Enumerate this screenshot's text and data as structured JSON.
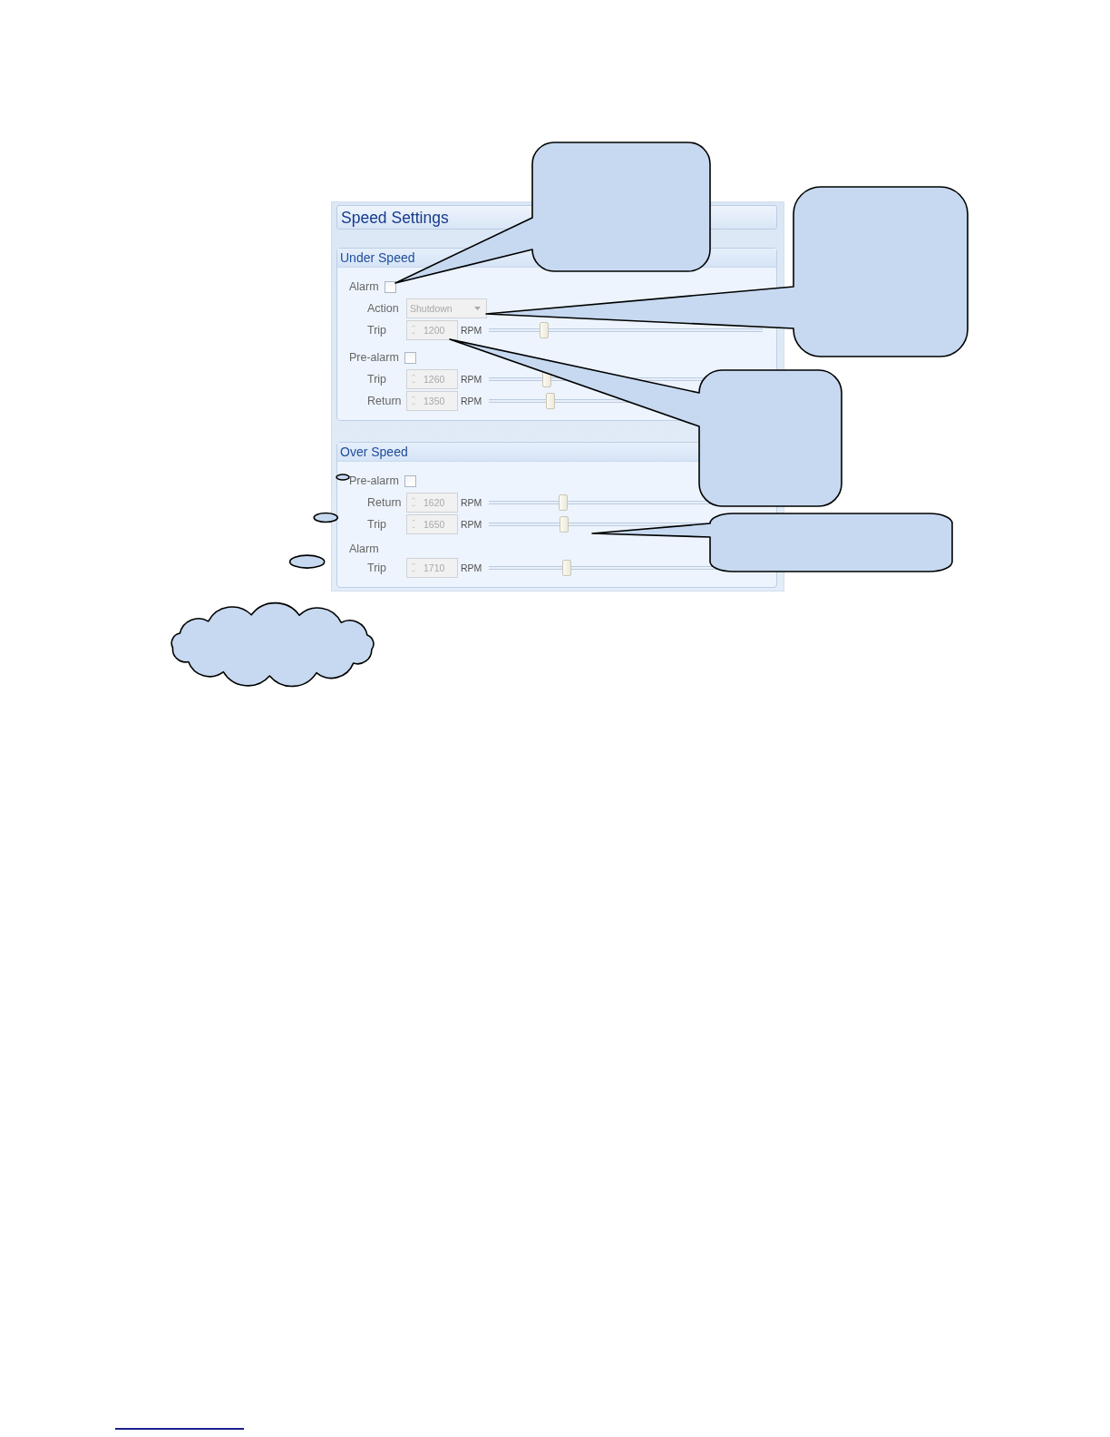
{
  "panel": {
    "title": "Speed Settings",
    "groups": [
      {
        "title": "Under Speed",
        "sections": [
          {
            "kind": "checkbox",
            "label": "Alarm",
            "checked": false,
            "children": [
              {
                "kind": "dropdown",
                "label": "Action",
                "value": "Shutdown",
                "disabled": true
              },
              {
                "kind": "spin",
                "label": "Trip",
                "value": "1200",
                "unit": "RPM",
                "level": 0.2,
                "disabled": true
              }
            ]
          },
          {
            "kind": "checkbox",
            "label": "Pre-alarm",
            "checked": false,
            "children": [
              {
                "kind": "spin",
                "label": "Trip",
                "value": "1260",
                "unit": "RPM",
                "level": 0.21,
                "disabled": true
              },
              {
                "kind": "spin",
                "label": "Return",
                "value": "1350",
                "unit": "RPM",
                "level": 0.225,
                "disabled": true
              }
            ]
          }
        ]
      },
      {
        "title": "Over Speed",
        "sections": [
          {
            "kind": "checkbox",
            "label": "Pre-alarm",
            "checked": false,
            "children": [
              {
                "kind": "spin",
                "label": "Return",
                "value": "1620",
                "unit": "RPM",
                "level": 0.27,
                "disabled": true
              },
              {
                "kind": "spin",
                "label": "Trip",
                "value": "1650",
                "unit": "RPM",
                "level": 0.275,
                "disabled": true
              }
            ]
          },
          {
            "kind": "heading",
            "label": "Alarm",
            "children": [
              {
                "kind": "spin",
                "label": "Trip",
                "value": "1710",
                "unit": "RPM",
                "level": 0.285,
                "disabled": true
              }
            ]
          }
        ]
      }
    ]
  },
  "callouts": [
    {
      "kind": "speech"
    },
    {
      "kind": "speech"
    },
    {
      "kind": "speech"
    },
    {
      "kind": "speech"
    },
    {
      "kind": "thought"
    }
  ]
}
